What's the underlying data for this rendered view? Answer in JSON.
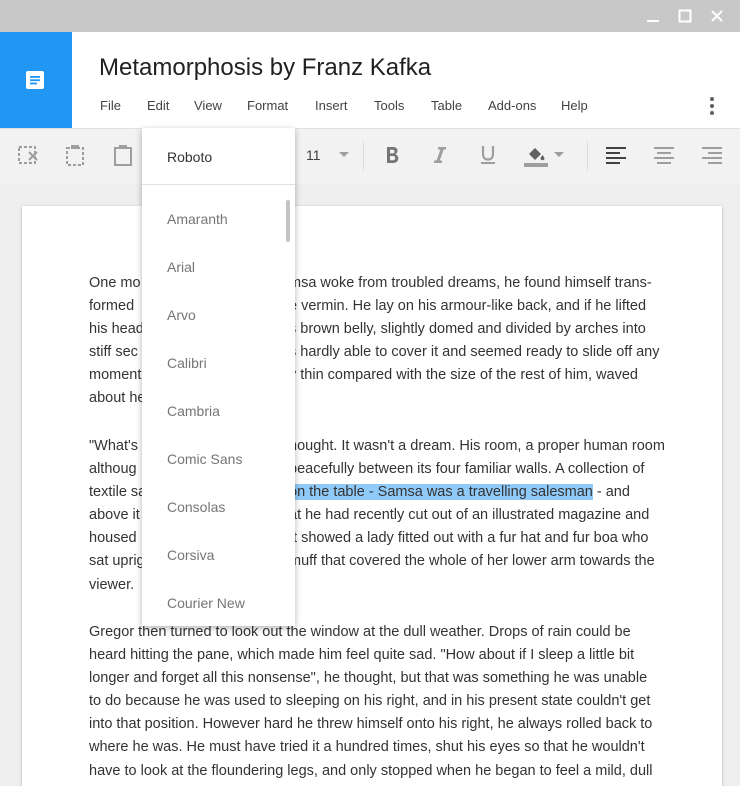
{
  "document": {
    "title": "Metamorphosis by Franz Kafka"
  },
  "menu": [
    "File",
    "Edit",
    "View",
    "Format",
    "Insert",
    "Tools",
    "Table",
    "Add-ons",
    "Help"
  ],
  "toolbar": {
    "font_size": "11",
    "icons": [
      "cut-icon",
      "copy-icon",
      "paste-icon",
      "bold-icon",
      "italic-icon",
      "underline-icon",
      "fill-color-icon",
      "align-left-icon",
      "align-center-icon",
      "align-right-icon"
    ]
  },
  "font_menu": {
    "current": "Roboto",
    "options": [
      "Amaranth",
      "Arial",
      "Arvo",
      "Calibri",
      "Cambria",
      "Comic Sans",
      "Consolas",
      "Corsiva",
      "Courier New"
    ]
  },
  "content": {
    "p1": [
      "One mo",
      "msa woke from troubled dreams, he found himself trans-",
      "formed",
      "e vermin. He lay on his armour-like back, and if he lifted",
      "his head",
      "s brown belly, slightly domed and divided by arches into",
      "stiff sec",
      "s hardly able to cover it and seemed ready to slide off any",
      "moment",
      "y thin compared with the size of the rest of him, waved",
      "about he"
    ],
    "p2": [
      "\"What's",
      "hought. It wasn't a dream. His room, a proper human room",
      "althoug",
      "peacefully between its four familiar walls. A collection of",
      "textile sa",
      "on the table - Samsa was a travelling salesman",
      " - and",
      "above it",
      "at he had recently cut out of an illustrated magazine and",
      "housed",
      "It showed a lady fitted out with a fur hat and fur boa who",
      "sat uprig",
      "muff that covered the whole of her lower arm towards the",
      "viewer."
    ],
    "p3": [
      "Gregor then turned to look out the window at the dull weather. Drops of rain could be",
      "heard hitting the pane, which made him feel quite sad. \"How about if I sleep a little bit",
      "longer and forget all this nonsense\", he thought, but that was something he was unable",
      "to do because he was used to sleeping on his right, and in his present state couldn't get",
      "into that position. However hard he threw himself onto his right, he always rolled back to",
      "where he was. He must have tried it a hundred times, shut his eyes so that he wouldn't",
      "have to look at the floundering legs, and only stopped when he began to feel a mild, dull"
    ]
  },
  "colors": {
    "accent": "#2196f3",
    "titlebar": "#c8c8c8",
    "highlight": "#90caf9"
  }
}
